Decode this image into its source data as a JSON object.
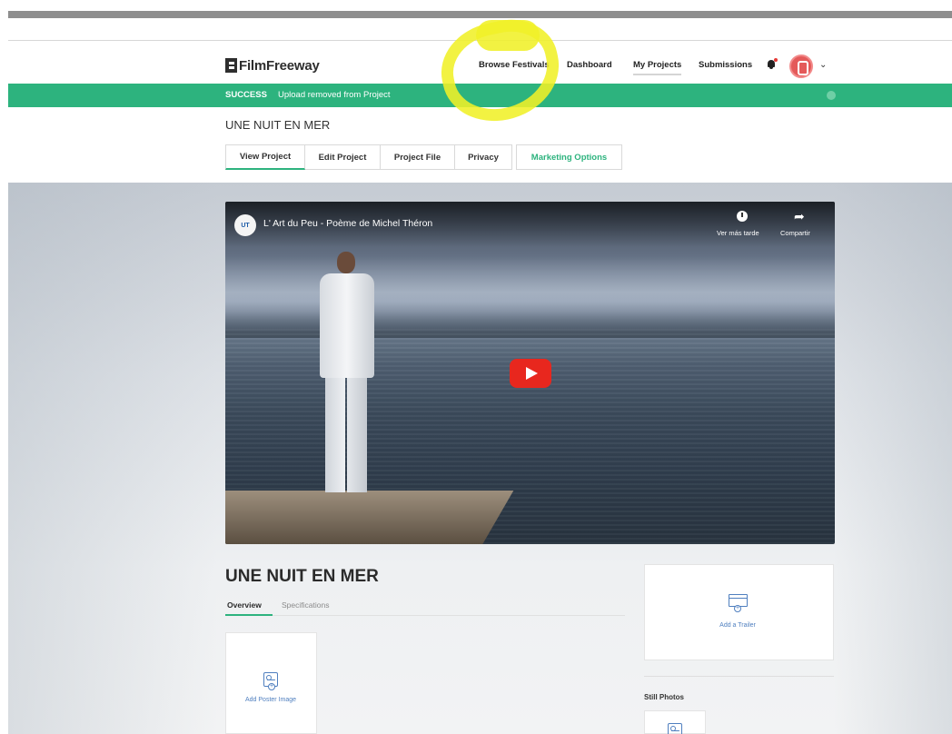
{
  "header": {
    "logo_text": "FilmFreeway",
    "nav": {
      "browse_festivals": "Browse Festivals",
      "dashboard": "Dashboard",
      "my_projects": "My Projects",
      "submissions": "Submissions"
    }
  },
  "alert": {
    "label": "SUCCESS",
    "message": "Upload removed from Project"
  },
  "project": {
    "title": "UNE NUIT EN MER",
    "tabs": [
      "View Project",
      "Edit Project",
      "Project File",
      "Privacy",
      "Marketing Options"
    ]
  },
  "video": {
    "channel_badge": "UT",
    "title": "L' Art du Peu - Poème de Michel Théron",
    "watch_later": "Ver más tarde",
    "share": "Compartir"
  },
  "details": {
    "title": "UNE NUIT EN MER",
    "subtabs": [
      "Overview",
      "Specifications"
    ],
    "add_poster": "Add Poster Image",
    "add_trailer": "Add a Trailer",
    "still_photos": "Still Photos"
  },
  "colors": {
    "brand_green": "#2db37e",
    "play_red": "#e8271e",
    "link_blue": "#4f7fbf",
    "highlight_yellow": "#f0f028"
  }
}
